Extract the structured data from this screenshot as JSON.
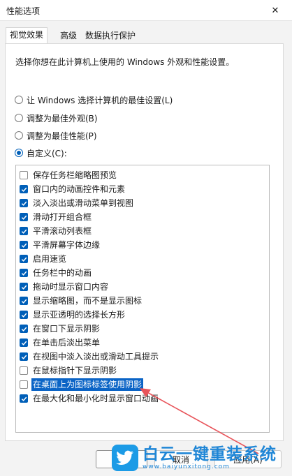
{
  "window": {
    "title": "性能选项"
  },
  "tabs": [
    {
      "label": "视觉效果",
      "active": true
    },
    {
      "label": "高级",
      "active": false
    },
    {
      "label": "数据执行保护",
      "active": false
    }
  ],
  "description": "选择你想在此计算机上使用的 Windows 外观和性能设置。",
  "radios": [
    {
      "label": "让 Windows 选择计算机的最佳设置(L)",
      "checked": false
    },
    {
      "label": "调整为最佳外观(B)",
      "checked": false
    },
    {
      "label": "调整为最佳性能(P)",
      "checked": false
    },
    {
      "label": "自定义(C):",
      "checked": true
    }
  ],
  "options": [
    {
      "label": "保存任务栏缩略图预览",
      "checked": false
    },
    {
      "label": "窗口内的动画控件和元素",
      "checked": true
    },
    {
      "label": "淡入淡出或滑动菜单到视图",
      "checked": true
    },
    {
      "label": "滑动打开组合框",
      "checked": true
    },
    {
      "label": "平滑滚动列表框",
      "checked": true
    },
    {
      "label": "平滑屏幕字体边缘",
      "checked": true
    },
    {
      "label": "启用速览",
      "checked": true
    },
    {
      "label": "任务栏中的动画",
      "checked": true
    },
    {
      "label": "拖动时显示窗口内容",
      "checked": true
    },
    {
      "label": "显示缩略图，而不是显示图标",
      "checked": true
    },
    {
      "label": "显示亚透明的选择长方形",
      "checked": true
    },
    {
      "label": "在窗口下显示阴影",
      "checked": true
    },
    {
      "label": "在单击后淡出菜单",
      "checked": true
    },
    {
      "label": "在视图中淡入淡出或滑动工具提示",
      "checked": true
    },
    {
      "label": "在鼠标指针下显示阴影",
      "checked": false
    },
    {
      "label": "在桌面上为图标标签使用阴影",
      "checked": false,
      "selected": true
    },
    {
      "label": "在最大化和最小化时显示窗口动画",
      "checked": true
    }
  ],
  "buttons": {
    "cancel": "取消",
    "apply": "应用(A)"
  },
  "watermark": {
    "main": "白云一键重装系统",
    "sub": "www.baiyunxitong.com"
  },
  "colors": {
    "accent": "#005fb8",
    "selection": "#0b64c6",
    "annotation_arrow": "#e8545a"
  }
}
